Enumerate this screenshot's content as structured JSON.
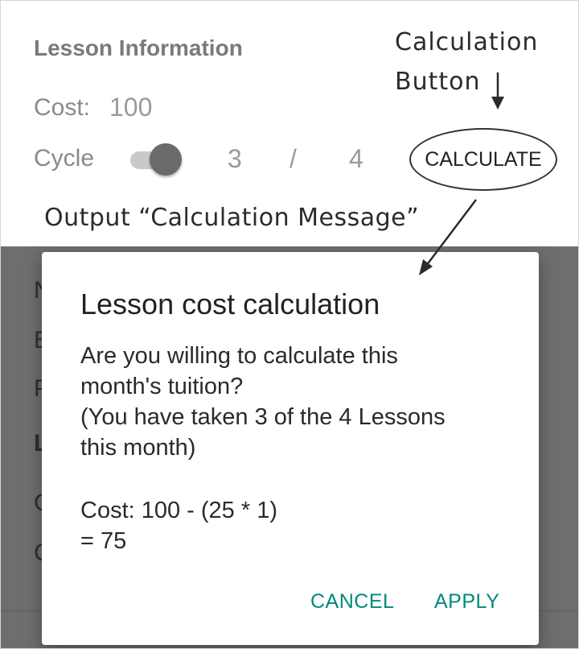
{
  "lesson": {
    "section_title": "Lesson Information",
    "cost_label": "Cost:",
    "cost_value": "100",
    "cycle_label": "Cycle",
    "cycle_toggle_on": true,
    "taken": "3",
    "separator": "/",
    "total": "4",
    "calculate_label": "CALCULATE"
  },
  "annotations": {
    "button_label_line1": "Calculation",
    "button_label_line2": "Button",
    "output_label": "Output “Calculation Message”"
  },
  "background_fragments": [
    "N",
    "E",
    "P",
    "L",
    "C",
    "C"
  ],
  "dialog": {
    "title": "Lesson cost calculation",
    "message_lines": [
      "Are you willing to calculate this",
      "month's tuition?",
      "(You have taken 3 of the 4 Lessons",
      "this month)"
    ],
    "cost_lines": [
      "Cost: 100 - (25 * 1)",
      "= 75"
    ],
    "cancel_label": "CANCEL",
    "apply_label": "APPLY"
  },
  "colors": {
    "accent": "#00897b",
    "scrim": "#6d6e6f",
    "label_gray": "#8a8a8a"
  }
}
